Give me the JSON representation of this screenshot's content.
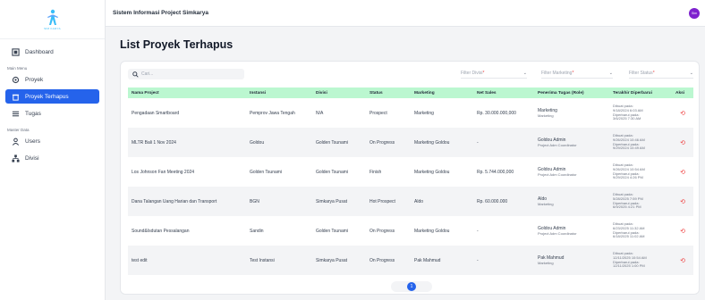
{
  "header": {
    "title": "Sistem Informasi Project Simkarya",
    "avatar_initials": "Sim"
  },
  "logo": {
    "text": "SIM KARYA"
  },
  "sidebar": {
    "dashboard": "Dashboard",
    "main_menu_label": "Main Menu",
    "proyek": "Proyek",
    "proyek_terhapus": "Proyek Terhapus",
    "tugas": "Tugas",
    "master_data_label": "Master Data",
    "users": "Users",
    "divisi": "Divisi"
  },
  "page": {
    "title": "List Proyek Terhapus"
  },
  "search": {
    "placeholder": "Cari..."
  },
  "filters": {
    "divisi": "Filter Divisi",
    "marketing": "Filter Marketing",
    "status": "Filter Status",
    "required_mark": "*",
    "chevron": "⌄"
  },
  "table": {
    "headers": [
      "Nama Project",
      "Instansi",
      "Divisi",
      "Status",
      "Marketing",
      "Net Sales",
      "Penerima Tugas (Role)",
      "Terakhir Diperbarui",
      "Aksi"
    ],
    "created_label": "Dibuat pada:",
    "updated_label": "Diperbarui pada:",
    "restore_glyph": "⟲",
    "rows": [
      {
        "nama": "Pengadaan Smartboard",
        "instansi": "Pemprov Jawa Tengah",
        "divisi": "N/A",
        "status": "Prospect",
        "marketing": "Marketing",
        "net_sales": "Rp. 30.000.000,000",
        "penerima": "Marketing",
        "role": "Marketing",
        "created": "9/18/2024 6:03 AM",
        "updated": "3/6/2025 7:30 AM"
      },
      {
        "nama": "MLTR Bali 1 Nov 2024",
        "instansi": "Goldou",
        "divisi": "Golden Tsunami",
        "status": "On Progress",
        "marketing": "Marketing Goldou",
        "net_sales": "-",
        "penerima": "Goldou Admin",
        "role": "Project Adm Coordinator",
        "created": "9/26/2024 10:46 AM",
        "updated": "9/29/2024 10:49 AM"
      },
      {
        "nama": "Los Johnson Fan Meeting 2024",
        "instansi": "Golden Tsunami",
        "divisi": "Golden Tsunami",
        "status": "Finish",
        "marketing": "Marketing Goldou",
        "net_sales": "Rp. 5.744.000,000",
        "penerima": "Goldou Admin",
        "role": "Project Adm Coordinator",
        "created": "9/26/2024 10:54 AM",
        "updated": "9/29/2024 4:26 PM"
      },
      {
        "nama": "Dana Talangan Uang Harian dan Transport",
        "instansi": "BGN",
        "divisi": "Simkarya Pusat",
        "status": "Hot Prospect",
        "marketing": "Aldo",
        "net_sales": "Rp. 60.000.000",
        "penerima": "Aldo",
        "role": "Marketing",
        "created": "5/28/2025 7:59 PM",
        "updated": "6/9/2025 4:21 PM"
      },
      {
        "nama": "Sound&Isdutan Pessalangan",
        "instansi": "Sandin",
        "divisi": "Golden Tsunami",
        "status": "On Progress",
        "marketing": "Marketing Goldou",
        "net_sales": "-",
        "penerima": "Goldou Admin",
        "role": "Project Adm Coordinator",
        "created": "6/23/2025 11:32 AM",
        "updated": "6/18/2025 11:02 AM"
      },
      {
        "nama": "test edit",
        "instansi": "Test Instansi",
        "divisi": "Simkarya Pusat",
        "status": "On Progress",
        "marketing": "Pak Mahmud",
        "net_sales": "-",
        "penerima": "Pak Mahmud",
        "role": "Marketing",
        "created": "12/11/2025 10:54 AM",
        "updated": "12/11/2025 1:00 PM"
      }
    ]
  },
  "pagination": {
    "current": "1"
  }
}
